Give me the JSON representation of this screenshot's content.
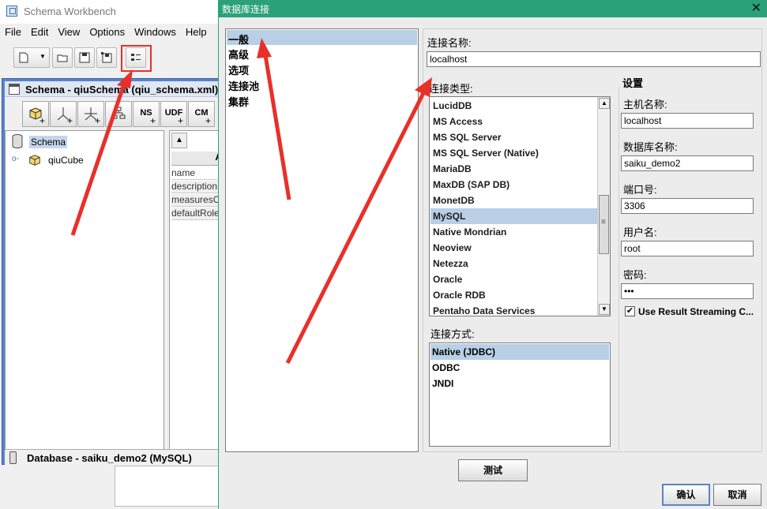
{
  "bg_app": {
    "title": "Schema Workbench",
    "menu": [
      "File",
      "Edit",
      "View",
      "Options",
      "Windows",
      "Help"
    ]
  },
  "schema_frame": {
    "title": "Schema - qiuSchema (qiu_schema.xml)",
    "tools": [
      {
        "label": "",
        "icon": "add-cube-icon"
      },
      {
        "label": "",
        "icon": "add-dimension-icon"
      },
      {
        "label": "",
        "icon": "add-dimension-usage-icon"
      },
      {
        "label": "",
        "icon": "add-hierarchy-icon"
      },
      {
        "label": "NS",
        "icon": "add-named-set-icon"
      },
      {
        "label": "UDF",
        "icon": "add-udf-icon"
      },
      {
        "label": "CM",
        "icon": "add-calculated-member-icon"
      }
    ],
    "tree": {
      "root": "Schema",
      "child": "qiuCube"
    },
    "props": {
      "header": "A",
      "rows": [
        "name",
        "description",
        "measuresC",
        "defaultRole"
      ]
    },
    "status": "Database - saiku_demo2 (MySQL)"
  },
  "dialog": {
    "title": "数据库连接",
    "close_symbol": "✕",
    "nav": [
      "一般",
      "高级",
      "选项",
      "连接池",
      "集群"
    ],
    "conn_name_label": "连接名称:",
    "conn_name_value": "localhost",
    "conn_type_label": "连接类型:",
    "conn_types": [
      "LucidDB",
      "MS Access",
      "MS SQL Server",
      "MS SQL Server (Native)",
      "MariaDB",
      "MaxDB (SAP DB)",
      "MonetDB",
      "MySQL",
      "Native Mondrian",
      "Neoview",
      "Netezza",
      "Oracle",
      "Oracle RDB",
      "Pentaho Data Services"
    ],
    "conn_type_selected": "MySQL",
    "access_label": "连接方式:",
    "access_methods": [
      "Native (JDBC)",
      "ODBC",
      "JNDI"
    ],
    "access_selected": "Native (JDBC)",
    "settings": {
      "title": "设置",
      "host_label": "主机名称:",
      "host_value": "localhost",
      "db_label": "数据库名称:",
      "db_value": "saiku_demo2",
      "port_label": "端口号:",
      "port_value": "3306",
      "user_label": "用户名:",
      "user_value": "root",
      "password_label": "密码:",
      "password_value": "•••",
      "streaming_label": "Use Result Streaming C...",
      "streaming_checked": "✔"
    },
    "test_button": "测试",
    "ok_button": "确认",
    "cancel_button": "取消"
  },
  "colors": {
    "dialog_titlebar": "#2aa179",
    "selection": "#b8cfe5",
    "annotation_red": "#e8302a",
    "frame_blue": "#5a83c9"
  }
}
